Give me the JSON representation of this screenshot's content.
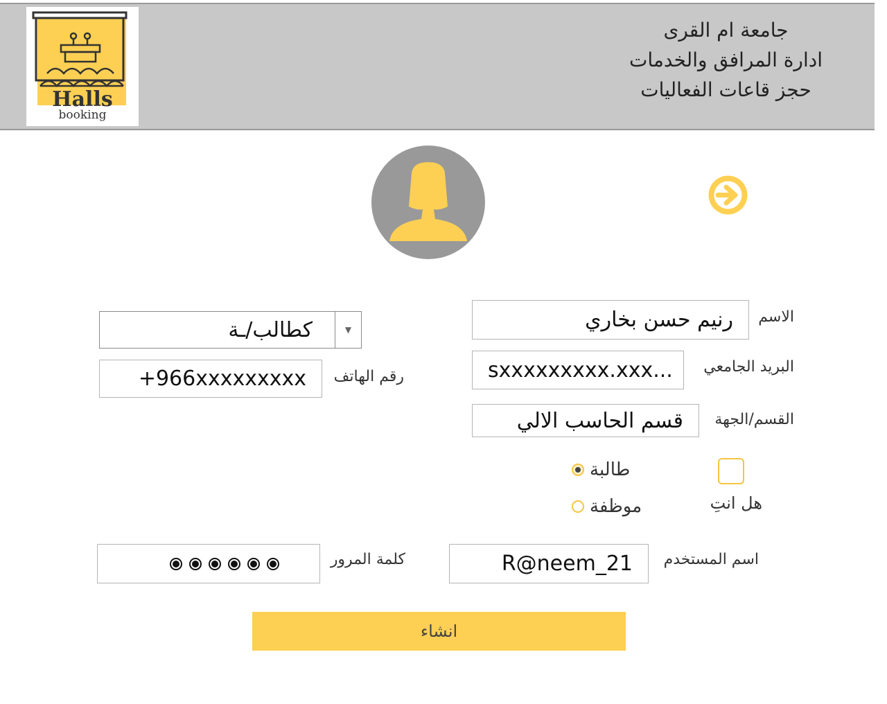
{
  "header": {
    "logo": {
      "word": "Halls",
      "subword": "booking"
    },
    "titles": [
      "جامعة ام القرى",
      "ادارة المرافق والخدمات",
      "حجز قاعات الفعاليات"
    ]
  },
  "icons": {
    "avatar": "female-user-avatar-icon",
    "next": "arrow-right-circle-icon"
  },
  "colors": {
    "accent": "#fdd053",
    "header_bg": "#c8c8c8",
    "avatar_bg": "#999999"
  },
  "form": {
    "name": {
      "label": "الاسم",
      "value": "رنيم حسن بخاري"
    },
    "role_select": {
      "value": "كطالب/ـة"
    },
    "email": {
      "label": "البريد الجامعي",
      "value": "sxxxxxxxxx.xxx..."
    },
    "phone": {
      "label": "رقم الهاتف",
      "value": "+966xxxxxxxxx"
    },
    "department": {
      "label": "القسم/الجهة",
      "value": "قسم الحاسب الالي"
    },
    "are_you": {
      "label": "هل انتِ",
      "options": [
        {
          "label": "طالبة",
          "selected": true
        },
        {
          "label": "موظفة",
          "selected": false
        }
      ]
    },
    "username": {
      "label": "اسم المستخدم",
      "value": "R@neem_21"
    },
    "password": {
      "label": "كلمة المرور",
      "length": 6
    },
    "submit_label": "انشاء"
  }
}
